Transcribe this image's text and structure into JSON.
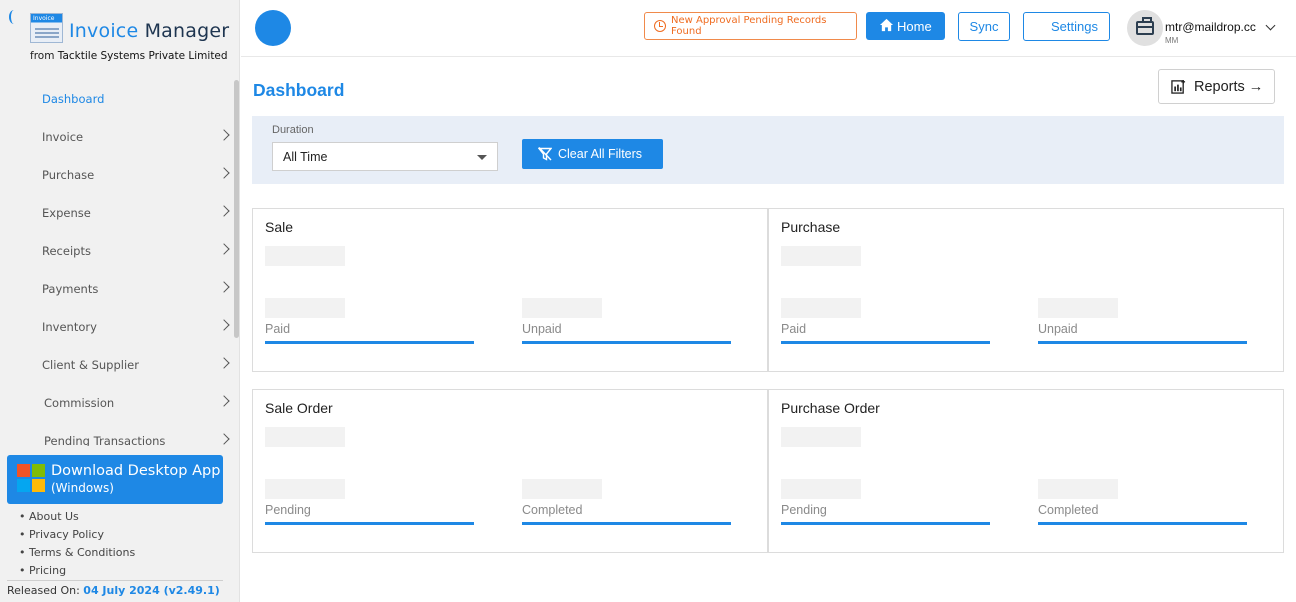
{
  "brand": {
    "logo_text": "Invoice",
    "title_part1": "Invoice ",
    "title_part2": "Manager",
    "subtitle_prefix": "from ",
    "subtitle_company": "Tacktile Systems Private Limited"
  },
  "sidebar": {
    "items": [
      {
        "label": "Dashboard",
        "active": true,
        "chevron": false
      },
      {
        "label": "Invoice",
        "chevron": true
      },
      {
        "label": "Purchase",
        "chevron": true
      },
      {
        "label": "Expense",
        "chevron": true
      },
      {
        "label": "Receipts",
        "chevron": true
      },
      {
        "label": "Payments",
        "chevron": true
      },
      {
        "label": "Inventory",
        "chevron": true
      },
      {
        "label": "Client & Supplier",
        "chevron": true
      },
      {
        "label": "Commission",
        "chevron": true
      },
      {
        "label": "Pending Transactions",
        "chevron": true
      }
    ],
    "download": {
      "line1": "Download Desktop App",
      "line2": "(Windows)"
    },
    "links": [
      "• About Us",
      "• Privacy Policy",
      "• Terms & Conditions",
      "• Pricing"
    ],
    "released_label": "Released On: ",
    "released_value": "04 July 2024 (v2.49.1)"
  },
  "header": {
    "alert": "New Approval Pending Records Found",
    "home": "Home",
    "sync": "Sync",
    "settings": "Settings",
    "user_email": "mtr@maildrop.cc",
    "user_sub": "MM"
  },
  "main": {
    "title": "Dashboard",
    "reports": "Reports →",
    "filter": {
      "label": "Duration",
      "value": "All Time",
      "clear": "Clear All Filters"
    },
    "cards": [
      {
        "title": "Sale",
        "left": "Paid",
        "right": "Unpaid"
      },
      {
        "title": "Purchase",
        "left": "Paid",
        "right": "Unpaid"
      },
      {
        "title": "Sale Order",
        "left": "Pending",
        "right": "Completed"
      },
      {
        "title": "Purchase Order",
        "left": "Pending",
        "right": "Completed"
      }
    ]
  },
  "colors": {
    "accent": "#1e88e5",
    "alert": "#ef6c21",
    "sidebar_bg": "#f1f1f1",
    "filter_bg": "#e8eef7"
  }
}
